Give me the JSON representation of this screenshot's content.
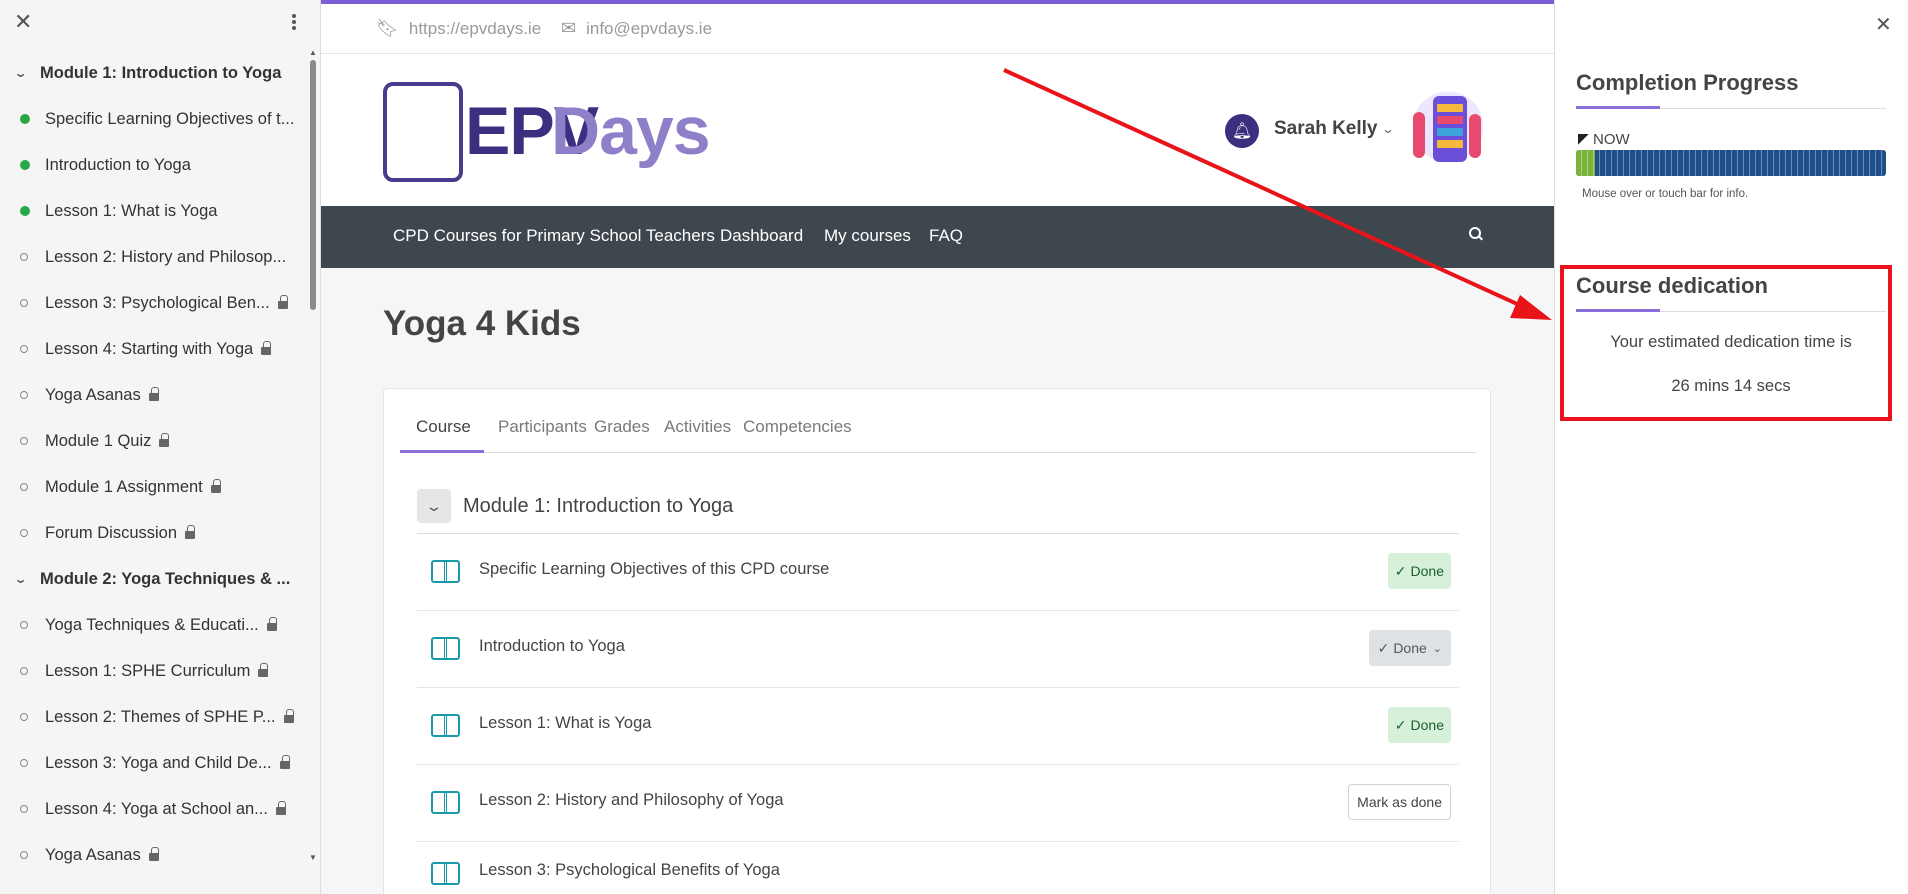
{
  "drawer": {
    "items": [
      {
        "type": "section",
        "label": "Module 1: Introduction to Yoga"
      },
      {
        "type": "child",
        "label": "Specific Learning Objectives of t...",
        "status": "done",
        "locked": false
      },
      {
        "type": "child",
        "label": "Introduction to Yoga",
        "status": "done",
        "locked": false
      },
      {
        "type": "child",
        "label": "Lesson 1: What is Yoga",
        "status": "done",
        "locked": false
      },
      {
        "type": "child",
        "label": "Lesson 2: History and Philosop...",
        "status": "todo",
        "locked": false
      },
      {
        "type": "child",
        "label": "Lesson 3: Psychological Ben...",
        "status": "todo",
        "locked": true
      },
      {
        "type": "child",
        "label": "Lesson 4: Starting with Yoga",
        "status": "todo",
        "locked": true
      },
      {
        "type": "child",
        "label": "Yoga Asanas",
        "status": "todo",
        "locked": true
      },
      {
        "type": "child",
        "label": "Module 1 Quiz",
        "status": "todo",
        "locked": true
      },
      {
        "type": "child",
        "label": "Module 1 Assignment",
        "status": "todo",
        "locked": true
      },
      {
        "type": "child",
        "label": "Forum Discussion",
        "status": "todo",
        "locked": true
      },
      {
        "type": "section",
        "label": "Module 2: Yoga Techniques & ..."
      },
      {
        "type": "child",
        "label": "Yoga Techniques & Educati...",
        "status": "todo",
        "locked": true
      },
      {
        "type": "child",
        "label": "Lesson 1: SPHE Curriculum",
        "status": "todo",
        "locked": true
      },
      {
        "type": "child",
        "label": "Lesson 2: Themes of SPHE P...",
        "status": "todo",
        "locked": true
      },
      {
        "type": "child",
        "label": "Lesson 3: Yoga and Child De...",
        "status": "todo",
        "locked": true
      },
      {
        "type": "child",
        "label": "Lesson 4: Yoga at School an...",
        "status": "todo",
        "locked": true
      },
      {
        "type": "child",
        "label": "Yoga Asanas",
        "status": "todo",
        "locked": true
      }
    ]
  },
  "topbar": {
    "website": "https://epvdays.ie",
    "email": "info@epvdays.ie"
  },
  "header": {
    "logo_part_a": "EPV",
    "logo_part_b": "Days",
    "user_name": "Sarah Kelly"
  },
  "nav": {
    "items": [
      "CPD Courses for Primary School Teachers",
      "Dashboard",
      "My courses",
      "FAQ"
    ]
  },
  "page": {
    "title": "Yoga 4 Kids"
  },
  "tabs": [
    "Course",
    "Participants",
    "Grades",
    "Activities",
    "Competencies"
  ],
  "module": {
    "title": "Module 1: Introduction to Yoga",
    "activities": [
      {
        "title": "Specific Learning Objectives of this CPD course",
        "state": "done",
        "action_label": "Done"
      },
      {
        "title": "Introduction to Yoga",
        "state": "done-dropdown",
        "action_label": "Done"
      },
      {
        "title": "Lesson 1: What is Yoga",
        "state": "done",
        "action_label": "Done"
      },
      {
        "title": "Lesson 2: History and Philosophy of Yoga",
        "state": "todo",
        "action_label": "Mark as done"
      },
      {
        "title": "Lesson 3: Psychological Benefits of Yoga",
        "state": "none",
        "action_label": ""
      }
    ]
  },
  "right_drawer": {
    "completion": {
      "title": "Completion Progress",
      "now_label": "NOW",
      "progress_fraction": 0.06,
      "hint": "Mouse over or touch bar for info."
    },
    "dedication": {
      "title": "Course dedication",
      "text": "Your estimated dedication time is",
      "time": "26 mins 14 secs"
    }
  },
  "colors": {
    "accent": "#7b5fd6",
    "nav_bg": "#3e474e",
    "done_dot": "#28a745",
    "progress_track": "#1f4f8a",
    "progress_fill": "#7bb33a",
    "annotation": "#e8141a"
  }
}
